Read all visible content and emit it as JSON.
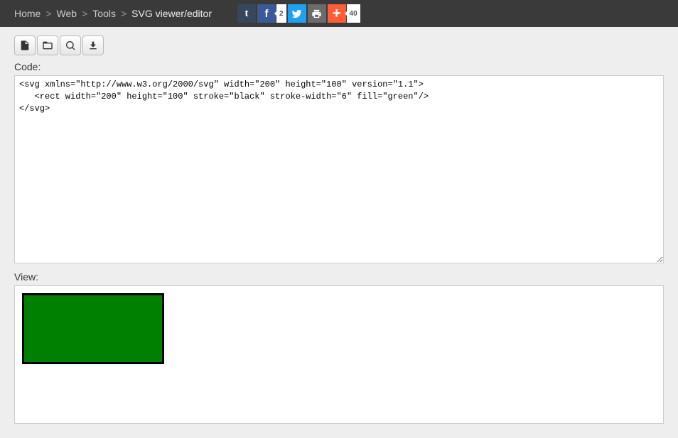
{
  "breadcrumb": {
    "home": "Home",
    "web": "Web",
    "tools": "Tools",
    "current": "SVG viewer/editor",
    "sep": ">"
  },
  "social": {
    "fb_count": "2",
    "share_count": "40"
  },
  "labels": {
    "code": "Code:",
    "view": "View:"
  },
  "code": "<svg xmlns=\"http://www.w3.org/2000/svg\" width=\"200\" height=\"100\" version=\"1.1\">\n   <rect width=\"200\" height=\"100\" stroke=\"black\" stroke-width=\"6\" fill=\"green\"/>\n</svg>",
  "svg_preview": {
    "width": "200",
    "height": "100",
    "stroke": "black",
    "stroke_width": "6",
    "fill": "green"
  }
}
